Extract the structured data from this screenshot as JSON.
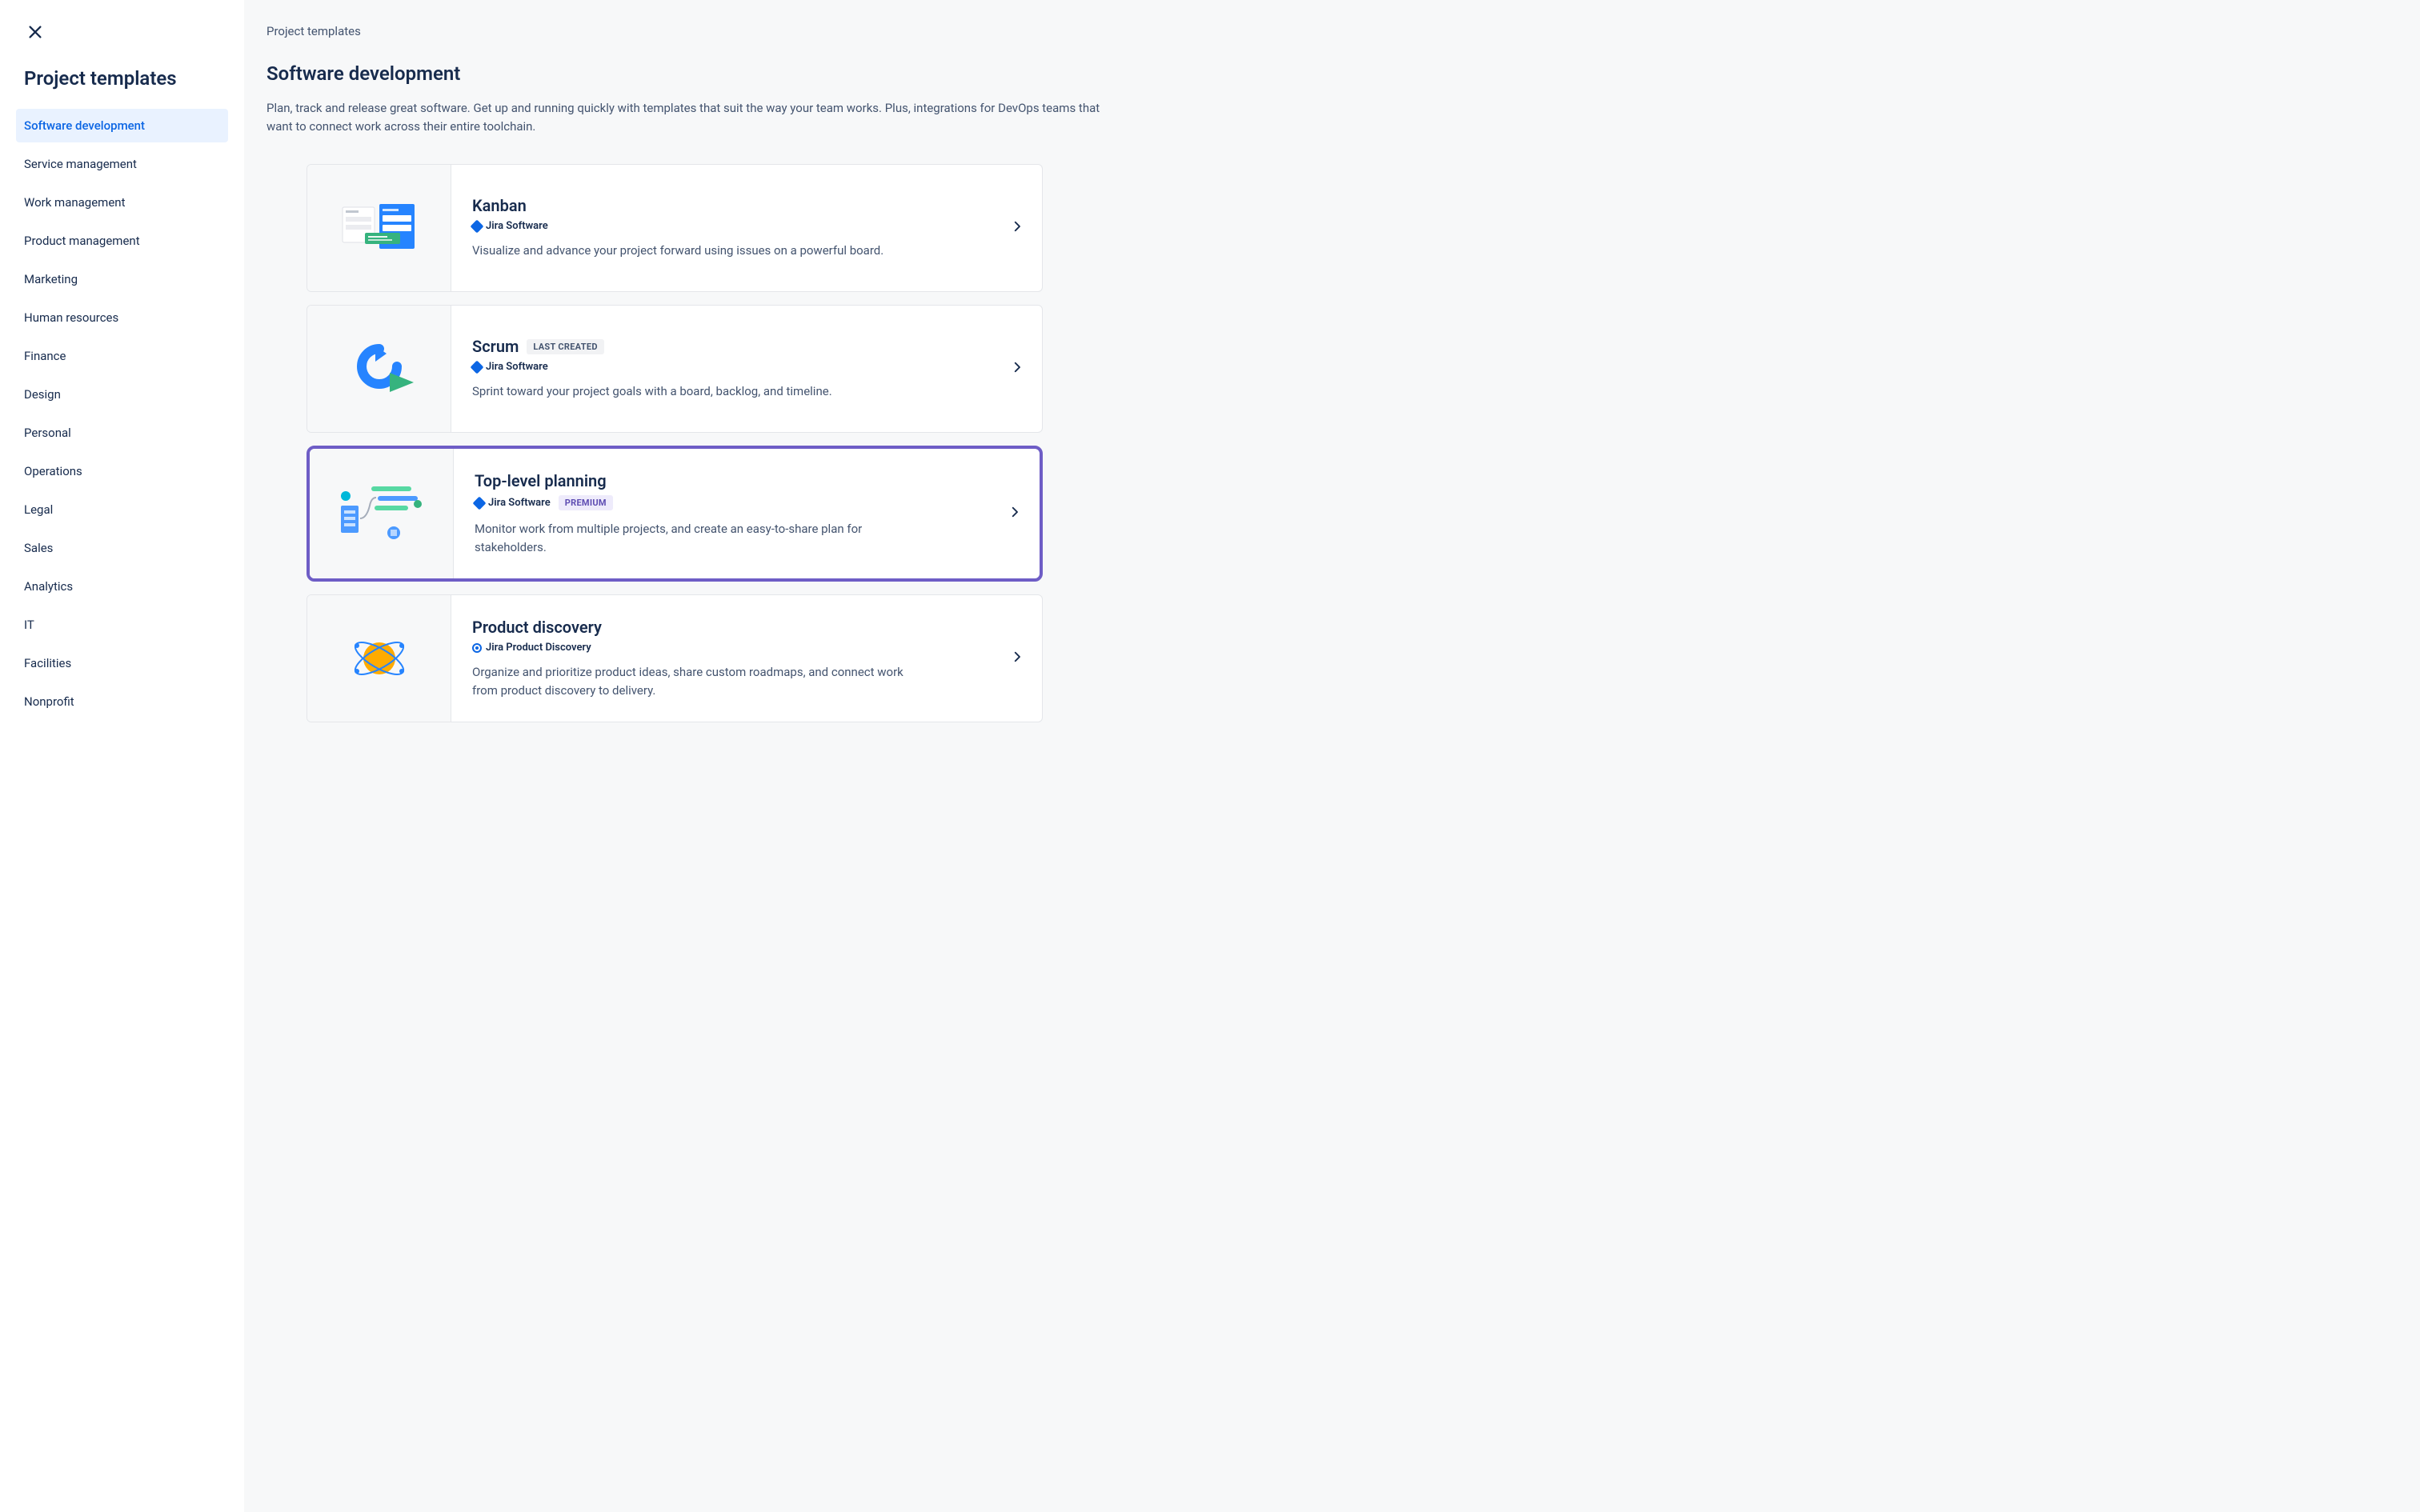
{
  "sidebar": {
    "title": "Project templates",
    "items": [
      {
        "label": "Software development",
        "active": true
      },
      {
        "label": "Service management",
        "active": false
      },
      {
        "label": "Work management",
        "active": false
      },
      {
        "label": "Product management",
        "active": false
      },
      {
        "label": "Marketing",
        "active": false
      },
      {
        "label": "Human resources",
        "active": false
      },
      {
        "label": "Finance",
        "active": false
      },
      {
        "label": "Design",
        "active": false
      },
      {
        "label": "Personal",
        "active": false
      },
      {
        "label": "Operations",
        "active": false
      },
      {
        "label": "Legal",
        "active": false
      },
      {
        "label": "Sales",
        "active": false
      },
      {
        "label": "Analytics",
        "active": false
      },
      {
        "label": "IT",
        "active": false
      },
      {
        "label": "Facilities",
        "active": false
      },
      {
        "label": "Nonprofit",
        "active": false
      }
    ]
  },
  "main": {
    "breadcrumb": "Project templates",
    "title": "Software development",
    "description": "Plan, track and release great software. Get up and running quickly with templates that suit the way your team works. Plus, integrations for DevOps teams that want to connect work across their entire toolchain.",
    "cards": [
      {
        "title": "Kanban",
        "product": "Jira Software",
        "product_icon": "jira-software",
        "badges": [],
        "desc": "Visualize and advance your project forward using issues on a powerful board.",
        "highlight": false
      },
      {
        "title": "Scrum",
        "product": "Jira Software",
        "product_icon": "jira-software",
        "badges": [
          {
            "text": "LAST CREATED",
            "kind": "gray"
          }
        ],
        "desc": "Sprint toward your project goals with a board, backlog, and timeline.",
        "highlight": false
      },
      {
        "title": "Top-level planning",
        "product": "Jira Software",
        "product_icon": "jira-software",
        "badges": [
          {
            "text": "PREMIUM",
            "kind": "premium"
          }
        ],
        "desc": "Monitor work from multiple projects, and create an easy-to-share plan for stakeholders.",
        "highlight": true
      },
      {
        "title": "Product discovery",
        "product": "Jira Product Discovery",
        "product_icon": "jira-product-discovery",
        "badges": [],
        "desc": "Organize and prioritize product ideas, share custom roadmaps, and connect work from product discovery to delivery.",
        "highlight": false
      }
    ]
  },
  "colors": {
    "accent": "#0C66E4",
    "highlight_border": "#6E5DC6",
    "premium_bg": "#EEEBFB",
    "premium_fg": "#5E4DB2"
  }
}
